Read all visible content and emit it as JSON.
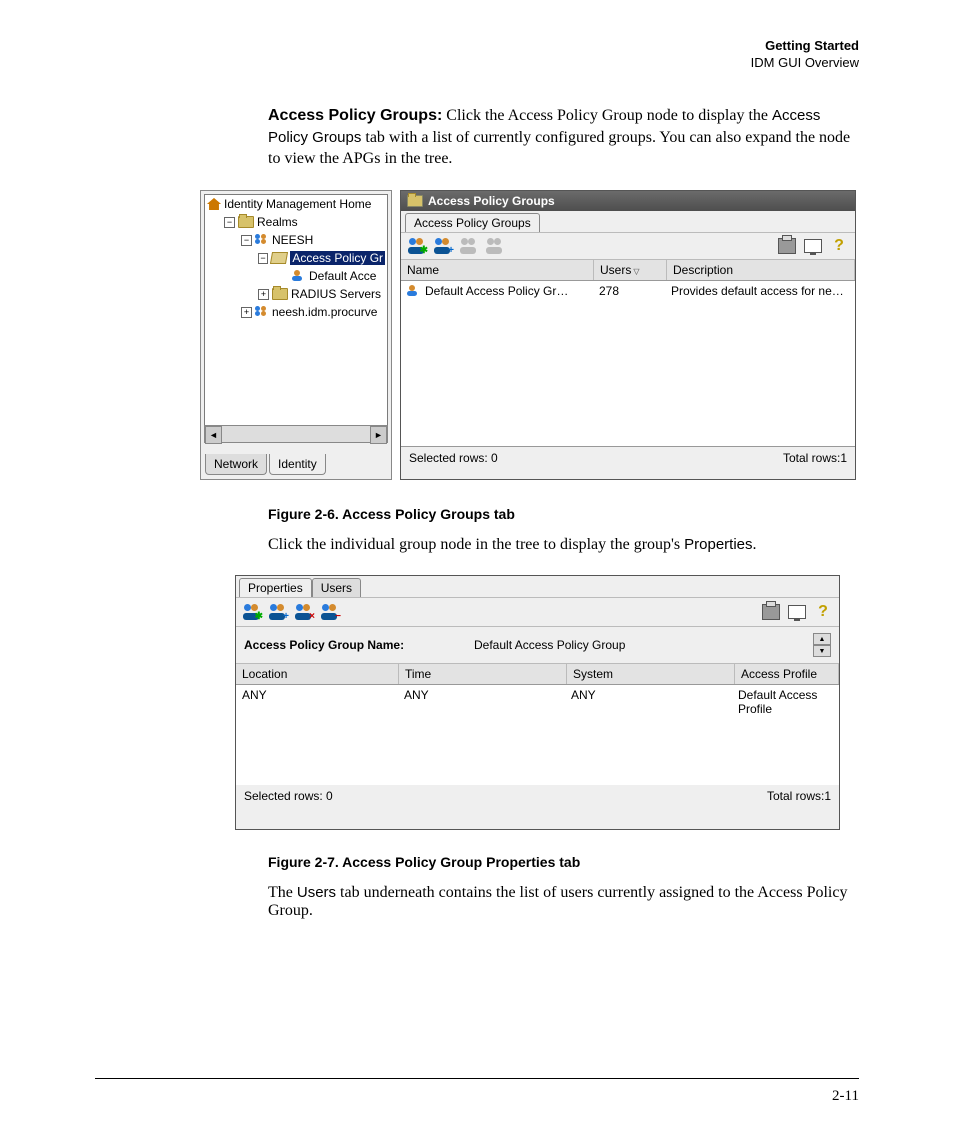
{
  "header": {
    "line1": "Getting Started",
    "line2": "IDM GUI Overview"
  },
  "intro": {
    "bold": "Access Policy Groups:",
    "text_a": " Click the Access Policy Group node to display the ",
    "gui_a": "Access Policy Groups",
    "text_b": " tab with a list of currently configured groups. You can also expand the node to view the APGs in the tree."
  },
  "fig1": {
    "tree": {
      "root": "Identity Management Home",
      "realms": "Realms",
      "neesh": "NEESH",
      "apg": "Access Policy Gr",
      "default": "Default Acce",
      "radius": "RADIUS Servers",
      "domain": "neesh.idm.procurve",
      "tab_network": "Network",
      "tab_identity": "Identity"
    },
    "panel": {
      "title": "Access Policy Groups",
      "subtab": "Access Policy Groups",
      "col_name": "Name",
      "col_users": "Users",
      "col_desc": "Description",
      "row_name": "Default Access Policy Gr…",
      "row_users": "278",
      "row_desc": "Provides default access for ne…",
      "selected": "Selected rows: 0",
      "total": "Total rows:1"
    }
  },
  "caption1": "Figure 2-6. Access Policy Groups tab",
  "para2": {
    "text_a": "Click the individual group node in the tree to display the group's ",
    "gui_a": "Properties",
    "text_b": "."
  },
  "fig2": {
    "tab_props": "Properties",
    "tab_users": "Users",
    "name_label": "Access Policy Group Name:",
    "name_value": "Default Access Policy Group",
    "col_loc": "Location",
    "col_time": "Time",
    "col_sys": "System",
    "col_prof": "Access Profile",
    "row_loc": "ANY",
    "row_time": "ANY",
    "row_sys": "ANY",
    "row_prof": "Default Access Profile",
    "selected": "Selected rows: 0",
    "total": "Total rows:1"
  },
  "caption2": "Figure 2-7. Access Policy Group Properties tab",
  "para3": {
    "text_a": "The ",
    "gui_a": "Users",
    "text_b": " tab underneath contains the list of users currently assigned to the Access Policy Group."
  },
  "pagenum": "2-11"
}
